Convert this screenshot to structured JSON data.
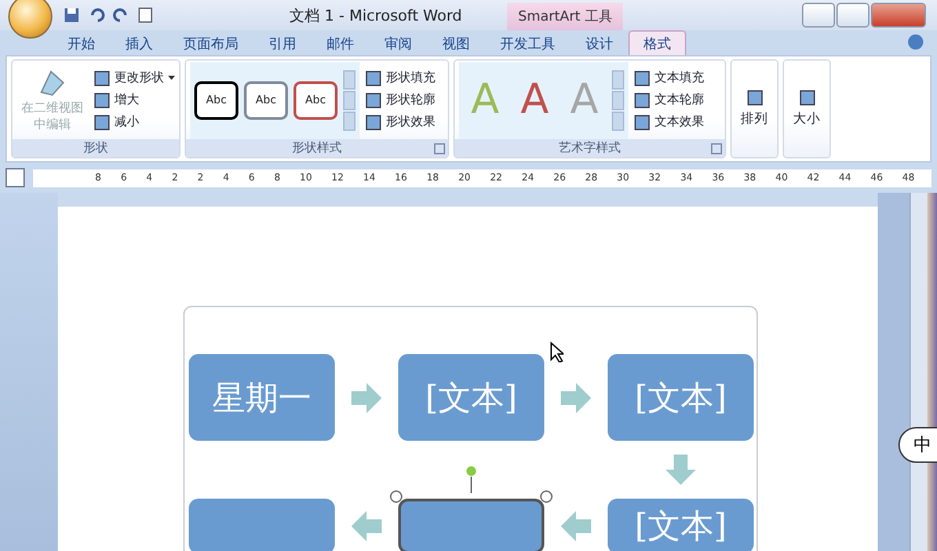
{
  "window": {
    "title": "文档 1 - Microsoft Word",
    "contextual_tab": "SmartArt 工具"
  },
  "tabs": [
    {
      "label": "开始",
      "selected": false
    },
    {
      "label": "插入",
      "selected": false
    },
    {
      "label": "页面布局",
      "selected": false
    },
    {
      "label": "引用",
      "selected": false
    },
    {
      "label": "邮件",
      "selected": false
    },
    {
      "label": "审阅",
      "selected": false
    },
    {
      "label": "视图",
      "selected": false
    },
    {
      "label": "开发工具",
      "selected": false
    },
    {
      "label": "设计",
      "selected": false
    },
    {
      "label": "格式",
      "selected": true
    }
  ],
  "ribbon": {
    "shapes": {
      "label": "形状",
      "edit_2d": {
        "label": "在二维视图中编辑",
        "disabled": true
      },
      "commands": [
        {
          "label": "更改形状",
          "dropdown": true
        },
        {
          "label": "增大",
          "dropdown": false
        },
        {
          "label": "减小",
          "dropdown": false
        }
      ]
    },
    "shape_styles": {
      "label": "形状样式",
      "samples": [
        {
          "text": "Abc",
          "color": "#000000"
        },
        {
          "text": "Abc",
          "color": "#7f8c99"
        },
        {
          "text": "Abc",
          "color": "#c0504d"
        }
      ],
      "commands": [
        "形状填充",
        "形状轮廓",
        "形状效果"
      ]
    },
    "wordart_styles": {
      "label": "艺术字样式",
      "samples": [
        {
          "text": "A",
          "color": "#9bbb59"
        },
        {
          "text": "A",
          "color": "#c0504d"
        },
        {
          "text": "A",
          "color": "#a6a6a6"
        }
      ],
      "commands": [
        "文本填充",
        "文本轮廓",
        "文本效果"
      ]
    },
    "arrange": {
      "label": "排列"
    },
    "size": {
      "label": "大小"
    }
  },
  "ruler": [
    "8",
    "6",
    "4",
    "2",
    "2",
    "4",
    "6",
    "8",
    "10",
    "12",
    "14",
    "16",
    "18",
    "20",
    "22",
    "24",
    "26",
    "28",
    "30",
    "32",
    "34",
    "36",
    "38",
    "40",
    "42",
    "44",
    "46",
    "48"
  ],
  "diagram": {
    "nodes": [
      {
        "text": "星期一",
        "selected": false
      },
      {
        "text": "[文本]",
        "selected": false
      },
      {
        "text": "[文本]",
        "selected": false
      },
      {
        "text": "[文本]",
        "selected": false
      },
      {
        "selected": true
      },
      {
        "selected": false
      }
    ]
  },
  "ime_indicator": "中"
}
